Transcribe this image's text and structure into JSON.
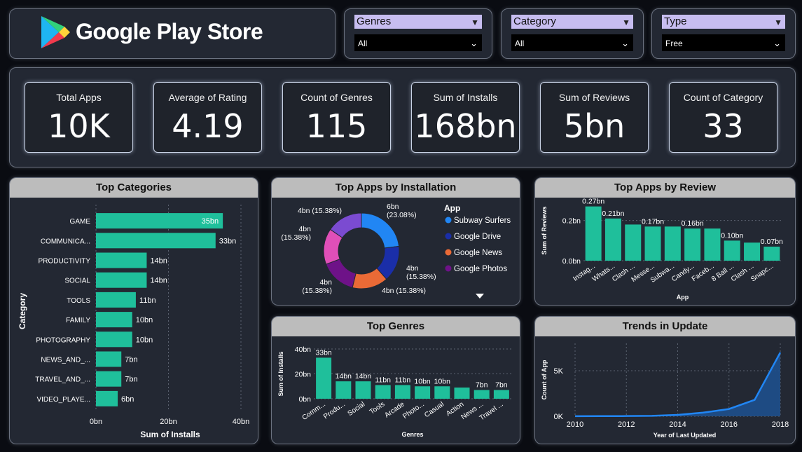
{
  "header": {
    "title": "Google Play Store"
  },
  "filters": [
    {
      "label": "Genres",
      "value": "All"
    },
    {
      "label": "Category",
      "value": "All"
    },
    {
      "label": "Type",
      "value": "Free"
    }
  ],
  "kpis": [
    {
      "label": "Total Apps",
      "value": "10K"
    },
    {
      "label": "Average of Rating",
      "value": "4.19"
    },
    {
      "label": "Count of Genres",
      "value": "115"
    },
    {
      "label": "Sum of Installs",
      "value": "168bn"
    },
    {
      "label": "Sum of Reviews",
      "value": "5bn"
    },
    {
      "label": "Count of Category",
      "value": "33"
    }
  ],
  "colors": {
    "bar": "#1fbf9b",
    "panel": "#232833",
    "header_bar": "#bcbcbc",
    "slicer_label": "#c7bdf0",
    "line": "#2186f4",
    "area": "#1e4f8c",
    "donut": [
      "#2186f4",
      "#1a2ea8",
      "#ea6a36",
      "#6e1288",
      "#e04fb8",
      "#7b4bd1"
    ]
  },
  "chart_data": [
    {
      "id": "top_categories",
      "type": "bar",
      "orientation": "horizontal",
      "title": "Top Categories",
      "xlabel": "Sum of Installs",
      "ylabel": "Category",
      "categories": [
        "GAME",
        "COMMUNICA...",
        "PRODUCTIVITY",
        "SOCIAL",
        "TOOLS",
        "FAMILY",
        "PHOTOGRAPHY",
        "NEWS_AND_...",
        "TRAVEL_AND_...",
        "VIDEO_PLAYE..."
      ],
      "values": [
        35,
        33,
        14,
        14,
        11,
        10,
        10,
        7,
        7,
        6
      ],
      "data_labels": [
        "35bn",
        "33bn",
        "14bn",
        "14bn",
        "11bn",
        "10bn",
        "10bn",
        "7bn",
        "7bn",
        "6bn"
      ],
      "xticks": [
        "0bn",
        "20bn",
        "40bn"
      ],
      "xlim": [
        0,
        40
      ],
      "grid": true
    },
    {
      "id": "top_apps_installation",
      "type": "pie",
      "donut": true,
      "title": "Top Apps by Installation",
      "legend_title": "App",
      "legend": [
        "Subway Surfers",
        "Google Drive",
        "Google News",
        "Google Photos"
      ],
      "values": [
        6,
        4,
        4,
        4,
        4,
        4
      ],
      "labels": [
        [
          "6bn",
          "(23.08%)"
        ],
        [
          "4bn",
          "(15.38%)"
        ],
        [
          "4bn (15.38%)"
        ],
        [
          "4bn",
          "(15.38%)"
        ],
        [
          "4bn",
          "(15.38%)"
        ],
        [
          "4bn (15.38%)"
        ]
      ],
      "legend_placement": "right"
    },
    {
      "id": "top_apps_review",
      "type": "bar",
      "title": "Top Apps by Review",
      "xlabel": "App",
      "ylabel": "Sum of Reviews",
      "categories": [
        "Instag...",
        "Whats...",
        "Clash ...",
        "Messe...",
        "Subwa...",
        "Candy...",
        "Faceb...",
        "8 Ball ...",
        "Clash ...",
        "Snapc..."
      ],
      "values": [
        0.27,
        0.21,
        0.18,
        0.17,
        0.17,
        0.16,
        0.16,
        0.1,
        0.09,
        0.07
      ],
      "data_labels": [
        "0.27bn",
        "0.21bn",
        "",
        "0.17bn",
        "",
        "0.16bn",
        "",
        "0.10bn",
        "",
        "0.07bn"
      ],
      "yticks": [
        "0.0bn",
        "0.2bn"
      ],
      "ylim": [
        0,
        0.3
      ],
      "grid": true
    },
    {
      "id": "top_genres",
      "type": "bar",
      "title": "Top Genres",
      "xlabel": "Genres",
      "ylabel": "Sum of Installs",
      "categories": [
        "Comm...",
        "Produ...",
        "Social",
        "Tools",
        "Arcade",
        "Photo...",
        "Casual",
        "Action",
        "News ...",
        "Travel ..."
      ],
      "values": [
        33,
        14,
        14,
        11,
        11,
        10,
        10,
        9,
        7,
        7
      ],
      "data_labels": [
        "33bn",
        "14bn",
        "14bn",
        "11bn",
        "11bn",
        "10bn",
        "10bn",
        "",
        "7bn",
        "7bn"
      ],
      "yticks": [
        "0bn",
        "20bn",
        "40bn"
      ],
      "ylim": [
        0,
        40
      ],
      "grid": true
    },
    {
      "id": "trends_update",
      "type": "area",
      "title": "Trends in Update",
      "xlabel": "Year of Last Updated",
      "ylabel": "Count of App",
      "x": [
        2010,
        2011,
        2012,
        2013,
        2014,
        2015,
        2016,
        2017,
        2018
      ],
      "y": [
        10,
        15,
        25,
        50,
        150,
        400,
        800,
        1800,
        7000
      ],
      "xticks": [
        "2010",
        "2012",
        "2014",
        "2016",
        "2018"
      ],
      "yticks": [
        "0K",
        "5K"
      ],
      "xlim": [
        2010,
        2018
      ],
      "ylim": [
        0,
        8000
      ],
      "grid": true
    }
  ]
}
